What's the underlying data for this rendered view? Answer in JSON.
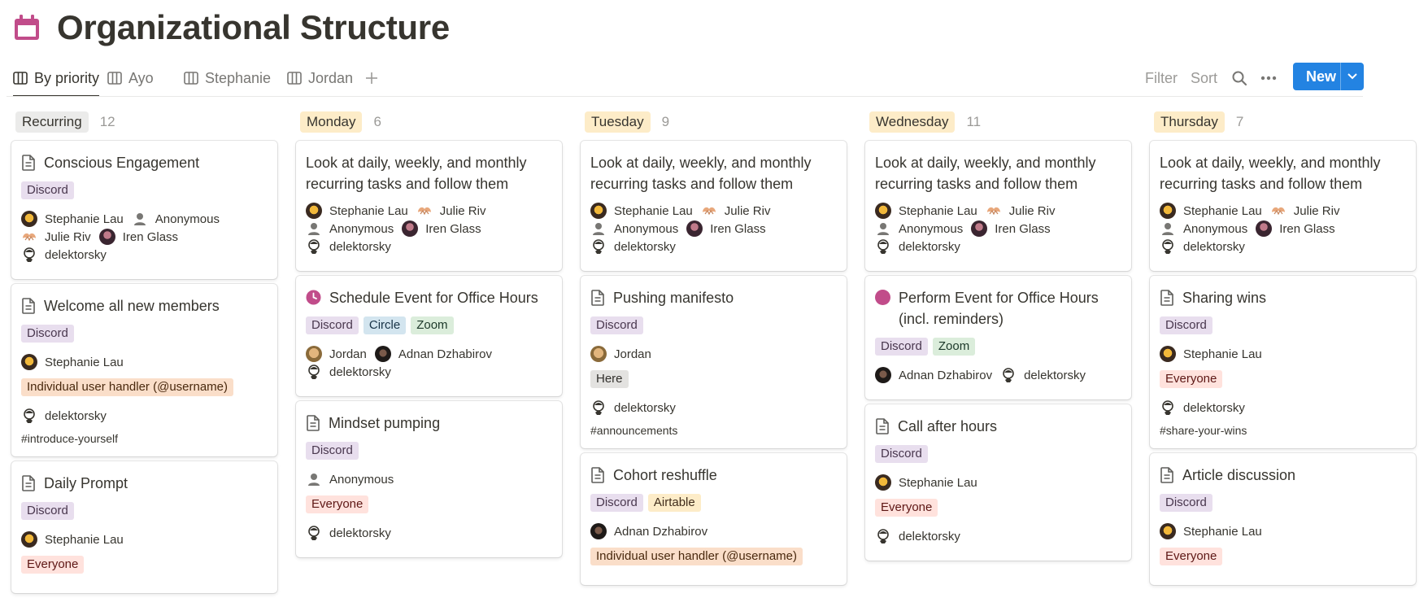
{
  "page": {
    "title": "Organizational Structure",
    "icon": "calendar-icon",
    "accent": "#c14c8a"
  },
  "views": [
    {
      "label": "By priority",
      "active": true
    },
    {
      "label": "Ayo"
    },
    {
      "label": "Stephanie"
    },
    {
      "label": "Jordan"
    }
  ],
  "toolbar": {
    "filter": "Filter",
    "sort": "Sort",
    "new": "New"
  },
  "columns": [
    {
      "label": "Recurring",
      "count": "12",
      "color": "#ebebea",
      "cards": [
        {
          "title": "Conscious Engagement",
          "icon": "page-icon",
          "tags": [
            [
              "Discord",
              "discord"
            ]
          ],
          "people": [
            [
              "stephanie",
              "Stephanie Lau"
            ],
            [
              "anon",
              "Anonymous"
            ],
            [
              "julie",
              "Julie Riv"
            ],
            [
              "iren",
              "Iren Glass"
            ],
            [
              "del",
              "delektorsky"
            ]
          ]
        },
        {
          "title": "Welcome all new members",
          "icon": "page-icon",
          "tags": [
            [
              "Discord",
              "discord"
            ]
          ],
          "people": [
            [
              "stephanie",
              "Stephanie Lau"
            ]
          ],
          "extra": [
            [
              "Individual user handler (@username)",
              "orange"
            ]
          ],
          "people2": [
            [
              "del",
              "delektorsky"
            ]
          ],
          "channel": "#introduce-yourself"
        },
        {
          "title": "Daily Prompt",
          "icon": "page-icon",
          "tags": [
            [
              "Discord",
              "discord"
            ]
          ],
          "people": [
            [
              "stephanie",
              "Stephanie Lau"
            ]
          ],
          "extra": [
            [
              "Everyone",
              "red"
            ]
          ]
        }
      ]
    },
    {
      "label": "Monday",
      "count": "6",
      "color": "#fdecc8",
      "cards": [
        {
          "title": "Look at daily, weekly, and monthly recurring tasks and follow them",
          "icon": "",
          "people": [
            [
              "stephanie",
              "Stephanie Lau"
            ],
            [
              "julie",
              "Julie Riv"
            ],
            [
              "anon",
              "Anonymous"
            ],
            [
              "iren",
              "Iren Glass"
            ],
            [
              "del",
              "delektorsky"
            ]
          ]
        },
        {
          "title": "Schedule Event for Office Hours",
          "icon": "clock-icon",
          "tags": [
            [
              "Discord",
              "discord"
            ],
            [
              "Circle",
              "circle"
            ],
            [
              "Zoom",
              "zoom"
            ]
          ],
          "people": [
            [
              "jordan",
              "Jordan"
            ],
            [
              "adnan",
              "Adnan Dzhabirov"
            ],
            [
              "del",
              "delektorsky"
            ]
          ]
        },
        {
          "title": "Mindset pumping",
          "icon": "page-icon",
          "tags": [
            [
              "Discord",
              "discord"
            ]
          ],
          "people": [
            [
              "anon",
              "Anonymous"
            ]
          ],
          "extra": [
            [
              "Everyone",
              "red"
            ]
          ],
          "people2": [
            [
              "del",
              "delektorsky"
            ]
          ]
        }
      ]
    },
    {
      "label": "Tuesday",
      "count": "9",
      "color": "#fdecc8",
      "cards": [
        {
          "title": "Look at daily, weekly, and monthly recurring tasks and follow them",
          "icon": "",
          "people": [
            [
              "stephanie",
              "Stephanie Lau"
            ],
            [
              "julie",
              "Julie Riv"
            ],
            [
              "anon",
              "Anonymous"
            ],
            [
              "iren",
              "Iren Glass"
            ],
            [
              "del",
              "delektorsky"
            ]
          ]
        },
        {
          "title": "Pushing manifesto",
          "icon": "page-icon",
          "tags": [
            [
              "Discord",
              "discord"
            ]
          ],
          "people": [
            [
              "jordan",
              "Jordan"
            ]
          ],
          "extra": [
            [
              "Here",
              "gray"
            ]
          ],
          "people2": [
            [
              "del",
              "delektorsky"
            ]
          ],
          "channel": "#announcements"
        },
        {
          "title": "Cohort reshuffle",
          "icon": "page-icon",
          "tags": [
            [
              "Discord",
              "discord"
            ],
            [
              "Airtable",
              "airtable"
            ]
          ],
          "people": [
            [
              "adnan",
              "Adnan Dzhabirov"
            ]
          ],
          "extra": [
            [
              "Individual user handler (@username)",
              "orange"
            ]
          ]
        }
      ]
    },
    {
      "label": "Wednesday",
      "count": "11",
      "color": "#fdecc8",
      "cards": [
        {
          "title": "Look at daily, weekly, and monthly recurring tasks and follow them",
          "icon": "",
          "people": [
            [
              "stephanie",
              "Stephanie Lau"
            ],
            [
              "julie",
              "Julie Riv"
            ],
            [
              "anon",
              "Anonymous"
            ],
            [
              "iren",
              "Iren Glass"
            ],
            [
              "del",
              "delektorsky"
            ]
          ]
        },
        {
          "title": "Perform Event for Office Hours (incl. reminders)",
          "icon": "dot-icon",
          "tags": [
            [
              "Discord",
              "discord"
            ],
            [
              "Zoom",
              "zoom"
            ]
          ],
          "people": [
            [
              "adnan",
              "Adnan Dzhabirov"
            ],
            [
              "del",
              "delektorsky"
            ]
          ]
        },
        {
          "title": "Call after hours",
          "icon": "page-icon",
          "tags": [
            [
              "Discord",
              "discord"
            ]
          ],
          "people": [
            [
              "stephanie",
              "Stephanie Lau"
            ]
          ],
          "extra": [
            [
              "Everyone",
              "red"
            ]
          ],
          "people2": [
            [
              "del",
              "delektorsky"
            ]
          ]
        }
      ]
    },
    {
      "label": "Thursday",
      "count": "7",
      "color": "#fdecc8",
      "cards": [
        {
          "title": "Look at daily, weekly, and monthly recurring tasks and follow them",
          "icon": "",
          "people": [
            [
              "stephanie",
              "Stephanie Lau"
            ],
            [
              "julie",
              "Julie Riv"
            ],
            [
              "anon",
              "Anonymous"
            ],
            [
              "iren",
              "Iren Glass"
            ],
            [
              "del",
              "delektorsky"
            ]
          ]
        },
        {
          "title": "Sharing wins",
          "icon": "page-icon",
          "tags": [
            [
              "Discord",
              "discord"
            ]
          ],
          "people": [
            [
              "stephanie",
              "Stephanie Lau"
            ]
          ],
          "extra": [
            [
              "Everyone",
              "red"
            ]
          ],
          "people2": [
            [
              "del",
              "delektorsky"
            ]
          ],
          "channel": "#share-your-wins"
        },
        {
          "title": "Article discussion",
          "icon": "page-icon",
          "tags": [
            [
              "Discord",
              "discord"
            ]
          ],
          "people": [
            [
              "stephanie",
              "Stephanie Lau"
            ]
          ],
          "extra": [
            [
              "Everyone",
              "red"
            ]
          ]
        }
      ]
    }
  ]
}
